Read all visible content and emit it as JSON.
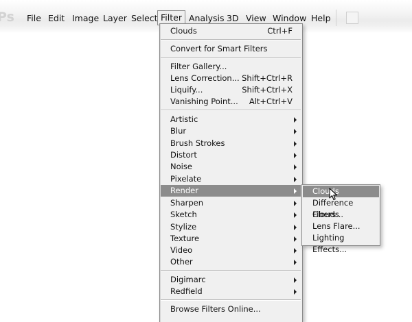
{
  "app": {
    "logo_text": "Ps"
  },
  "menubar": {
    "items": [
      {
        "label": "File"
      },
      {
        "label": "Edit"
      },
      {
        "label": "Image"
      },
      {
        "label": "Layer"
      },
      {
        "label": "Select"
      },
      {
        "label": "Filter"
      },
      {
        "label": "Analysis"
      },
      {
        "label": "3D"
      },
      {
        "label": "View"
      },
      {
        "label": "Window"
      },
      {
        "label": "Help"
      }
    ],
    "active": "Filter"
  },
  "filter_menu": {
    "items": [
      {
        "label": "Clouds",
        "shortcut": "Ctrl+F"
      },
      {
        "label": "Convert for Smart Filters"
      },
      {
        "label": "Filter Gallery..."
      },
      {
        "label": "Lens Correction...",
        "shortcut": "Shift+Ctrl+R"
      },
      {
        "label": "Liquify...",
        "shortcut": "Shift+Ctrl+X"
      },
      {
        "label": "Vanishing Point...",
        "shortcut": "Alt+Ctrl+V"
      },
      {
        "label": "Artistic",
        "submenu": true
      },
      {
        "label": "Blur",
        "submenu": true
      },
      {
        "label": "Brush Strokes",
        "submenu": true
      },
      {
        "label": "Distort",
        "submenu": true
      },
      {
        "label": "Noise",
        "submenu": true
      },
      {
        "label": "Pixelate",
        "submenu": true
      },
      {
        "label": "Render",
        "submenu": true,
        "highlighted": true
      },
      {
        "label": "Sharpen",
        "submenu": true
      },
      {
        "label": "Sketch",
        "submenu": true
      },
      {
        "label": "Stylize",
        "submenu": true
      },
      {
        "label": "Texture",
        "submenu": true
      },
      {
        "label": "Video",
        "submenu": true
      },
      {
        "label": "Other",
        "submenu": true
      },
      {
        "label": "Digimarc",
        "submenu": true
      },
      {
        "label": "Redfield",
        "submenu": true
      },
      {
        "label": "Browse Filters Online..."
      }
    ]
  },
  "render_submenu": {
    "items": [
      {
        "label": "Clouds",
        "highlighted": true
      },
      {
        "label": "Difference Clouds"
      },
      {
        "label": "Fibers..."
      },
      {
        "label": "Lens Flare..."
      },
      {
        "label": "Lighting Effects..."
      }
    ]
  },
  "colors": {
    "highlight": "#8c8c8c",
    "menu_bg": "#f0f0f0"
  }
}
